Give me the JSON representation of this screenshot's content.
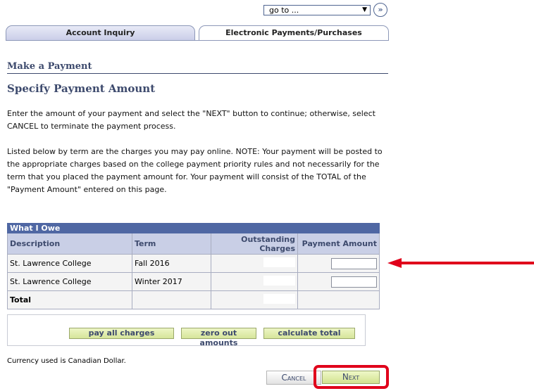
{
  "nav": {
    "goto_label": "go to ...",
    "goto_button": "»"
  },
  "tabs": [
    {
      "label": "Account Inquiry"
    },
    {
      "label": "Electronic Payments/Purchases"
    }
  ],
  "headings": {
    "section": "Make a Payment",
    "subsection": "Specify Payment Amount"
  },
  "instructions": {
    "p1": "Enter the amount of your payment and select the \"NEXT\" button to continue; otherwise, select CANCEL to terminate the payment process.",
    "p2": "Listed below by term are the charges you may pay online. NOTE: Your payment will be posted to the appropriate charges based on the college payment priority rules and not necessarily for the term that you placed the payment amount for. Your payment will consist of the TOTAL of the \"Payment Amount\" entered on this page."
  },
  "table": {
    "caption": "What I Owe",
    "headers": [
      "Description",
      "Term",
      "Outstanding Charges",
      "Payment Amount"
    ],
    "rows": [
      {
        "description": "St. Lawrence College",
        "term": "Fall 2016",
        "payment": ""
      },
      {
        "description": "St. Lawrence College",
        "term": "Winter 2017",
        "payment": ""
      }
    ],
    "total_label": "Total"
  },
  "actions": {
    "pay_all": "pay all charges",
    "zero_out": "zero out amounts",
    "calculate": "calculate total"
  },
  "currency_note": "Currency used is Canadian Dollar.",
  "footer": {
    "cancel": "Cancel",
    "next": "Next"
  },
  "colors": {
    "accent": "#4f67a3",
    "highlight": "#e0001b",
    "button_green": "#d6e59a"
  }
}
